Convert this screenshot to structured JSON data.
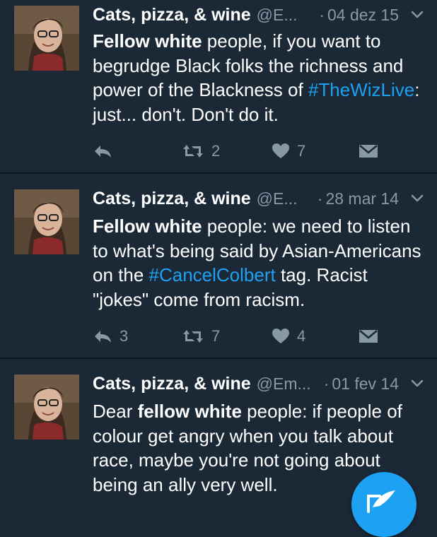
{
  "tweets": [
    {
      "name": "Cats, pizza, & wine",
      "handle": "@E...",
      "dot": "·",
      "date": "04 dez 15",
      "segments": [
        {
          "text": "Fellow white",
          "style": "bold"
        },
        {
          "text": " people, if you want to begrudge Black folks the richness and power of the Blackness of ",
          "style": "normal"
        },
        {
          "text": "#TheWizLive",
          "style": "tag"
        },
        {
          "text": ": just... don't. Don't do it.",
          "style": "normal"
        }
      ],
      "reply_count": "",
      "retweet_count": "2",
      "like_count": "7"
    },
    {
      "name": "Cats, pizza, & wine",
      "handle": "@E...",
      "dot": "·",
      "date": "28 mar 14",
      "segments": [
        {
          "text": "Fellow white",
          "style": "bold"
        },
        {
          "text": " people: we need to listen to what's being said by Asian-Americans on the ",
          "style": "normal"
        },
        {
          "text": "#CancelColbert",
          "style": "tag"
        },
        {
          "text": " tag. Racist \"jokes\" come from racism.",
          "style": "normal"
        }
      ],
      "reply_count": "3",
      "retweet_count": "7",
      "like_count": "4"
    },
    {
      "name": "Cats, pizza, & wine",
      "handle": "@Em...",
      "dot": "·",
      "date": "01 fev 14",
      "segments": [
        {
          "text": "Dear ",
          "style": "normal"
        },
        {
          "text": "fellow white",
          "style": "bold"
        },
        {
          "text": " people: if people of colour get angry when you talk about race, maybe you're not going about being an ally very well.",
          "style": "normal"
        }
      ],
      "reply_count": "",
      "retweet_count": "",
      "like_count": ""
    }
  ],
  "icons": {
    "reply": "reply-icon",
    "retweet": "retweet-icon",
    "like": "heart-icon",
    "dm": "envelope-icon",
    "more": "chevron-down-icon",
    "compose": "compose-icon"
  },
  "colors": {
    "background": "#1b2836",
    "divider": "#10171e",
    "text": "#ffffff",
    "muted": "#8899a6",
    "accent": "#1da1f2"
  }
}
